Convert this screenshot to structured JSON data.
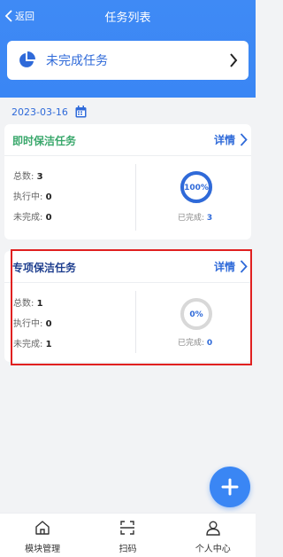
{
  "nav": {
    "back_label": "返回",
    "title": "任务列表"
  },
  "filter": {
    "label": "未完成任务"
  },
  "date": "2023-03-16",
  "cards": [
    {
      "title": "即时保洁任务",
      "detail_label": "详情",
      "total_label": "总数:",
      "total": "3",
      "running_label": "执行中:",
      "running": "0",
      "pending_label": "未完成:",
      "pending": "0",
      "percent_label": "100%",
      "percent": 100,
      "done_label": "已完成:",
      "done": "3"
    },
    {
      "title": "专项保洁任务",
      "detail_label": "详情",
      "total_label": "总数:",
      "total": "1",
      "running_label": "执行中:",
      "running": "0",
      "pending_label": "未完成:",
      "pending": "1",
      "percent_label": "0%",
      "percent": 0,
      "done_label": "已完成:",
      "done": "0"
    }
  ],
  "tabs": [
    {
      "label": "模块管理",
      "icon": "home-icon"
    },
    {
      "label": "扫码",
      "icon": "scan-icon"
    },
    {
      "label": "个人中心",
      "icon": "user-icon"
    }
  ],
  "colors": {
    "primary": "#3a86f4",
    "accent_text": "#2f6ad9",
    "card1_title": "#3aa86c",
    "card2_title": "#1f3f8f",
    "highlight": "#e02020"
  }
}
